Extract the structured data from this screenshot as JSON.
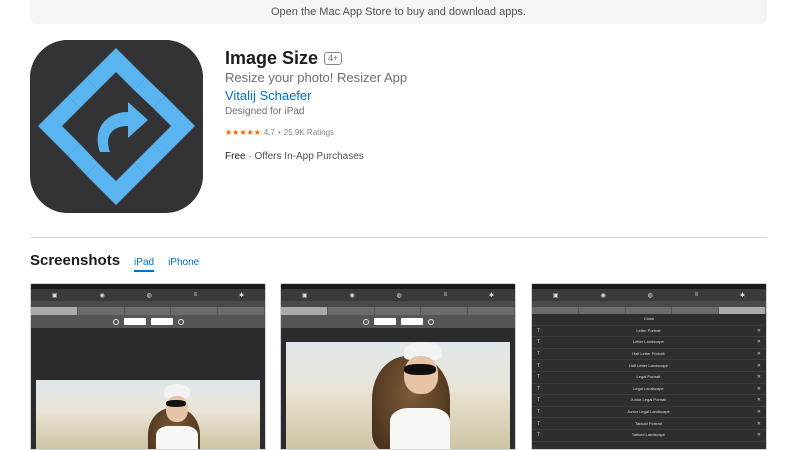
{
  "banner": {
    "text": "Open the Mac App Store to buy and download apps."
  },
  "app": {
    "title": "Image Size",
    "age_rating": "4+",
    "subtitle": "Resize your photo! Resizer App",
    "developer": "Vitalij Schaefer",
    "designed_for": "Designed for iPad",
    "stars": "★★★★★",
    "rating": "4.7",
    "rating_separator": "•",
    "ratings_count": "25.9K Ratings",
    "price": "Free",
    "price_separator": "·",
    "in_app": "Offers In-App Purchases",
    "icon_name": "resize-arrow-icon",
    "icon_color": "#5ab4f0",
    "icon_bg": "#333335"
  },
  "screenshots": {
    "title": "Screenshots",
    "tabs": [
      {
        "label": "iPad",
        "active": true
      },
      {
        "label": "iPhone",
        "active": false
      }
    ],
    "list_header": "Close",
    "list_items": [
      "Letter Portrait",
      "Letter Landscape",
      "Half Letter Portrait",
      "Half Letter Landscape",
      "Legal Portrait",
      "Legal Landscape",
      "Junior Legal Portrait",
      "Junior Legal Landscape",
      "Tabloid Portrait",
      "Tabloid Landscape"
    ]
  },
  "colors": {
    "link": "#0070c9",
    "star": "#f56300"
  }
}
